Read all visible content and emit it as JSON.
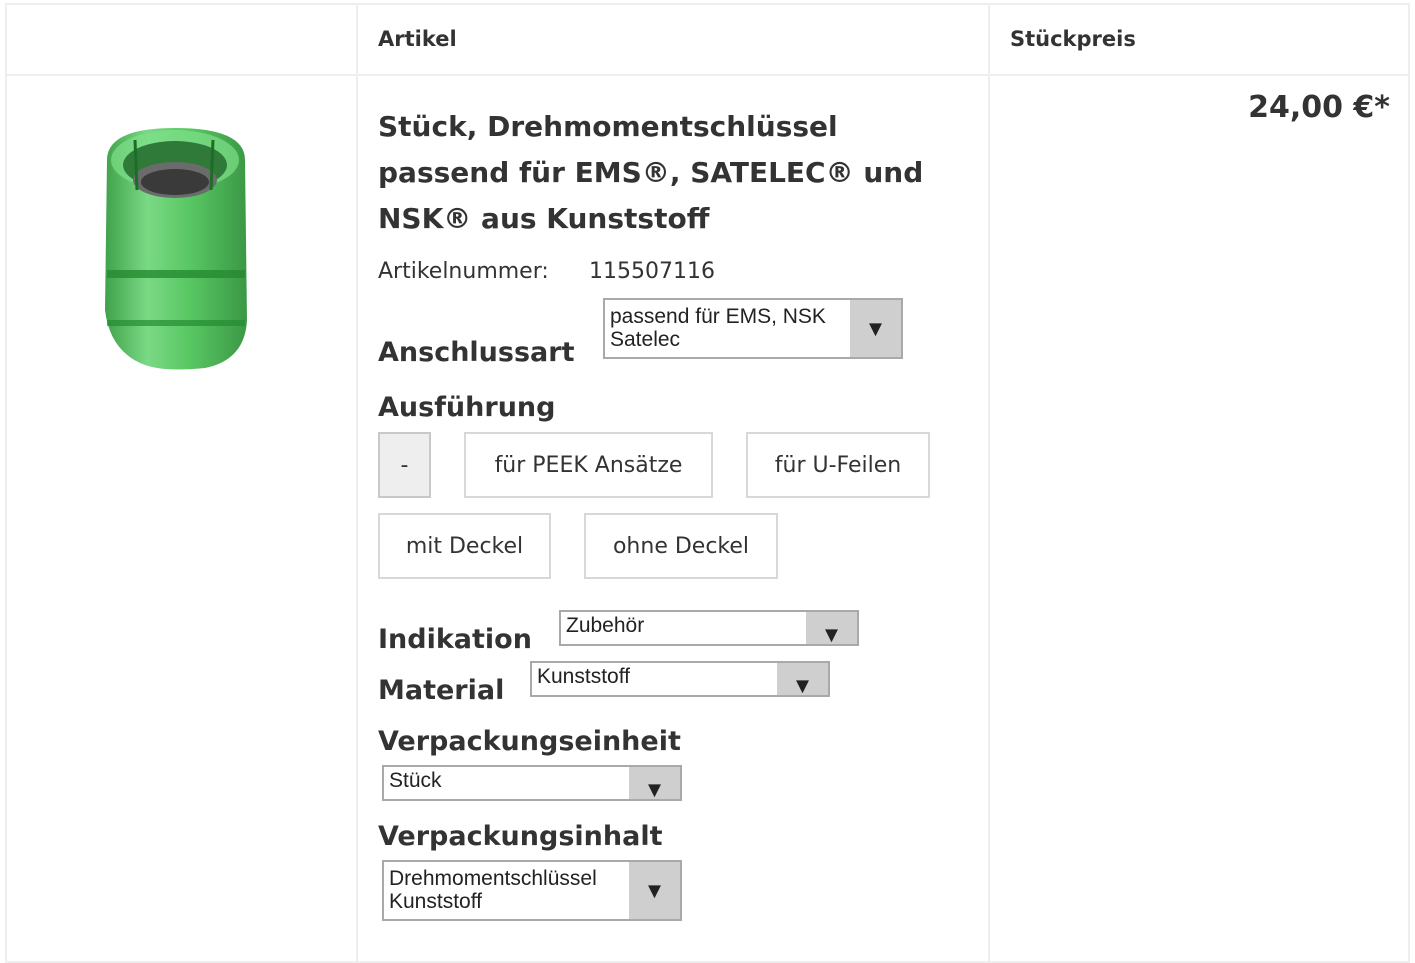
{
  "table": {
    "header": {
      "col_article": "Artikel",
      "col_price": "Stückpreis"
    }
  },
  "product": {
    "image_icon": "green-torque-wrench-image",
    "title": "Stück, Drehmomentschlüssel passend für EMS®, SATELEC® und NSK® aus Kunststoff",
    "article_number_label": "Artikelnummer:",
    "article_number": "115507116",
    "price": "24,00 €*"
  },
  "options": {
    "anschlussart": {
      "label": "Anschlussart",
      "value": "passend für EMS, NSK\nSatelec"
    },
    "ausfuehrung": {
      "label": "Ausführung",
      "choices": [
        "-",
        "für PEEK Ansätze",
        "für U-Feilen",
        "mit Deckel",
        "ohne Deckel"
      ],
      "selected": "-"
    },
    "indikation": {
      "label": "Indikation",
      "value": "Zubehör"
    },
    "material": {
      "label": "Material",
      "value": "Kunststoff"
    },
    "verpackungseinheit": {
      "label": "Verpackungseinheit",
      "value": "Stück"
    },
    "verpackungsinhalt": {
      "label": "Verpackungsinhalt",
      "value": "Drehmomentschlüssel\nKunststoff"
    }
  },
  "icons": {
    "dropdown": "triangle-down-icon"
  },
  "colors": {
    "border": "#eeeeee",
    "product_green": "#3cb44b",
    "arrow_bg": "#cfcfcf"
  }
}
